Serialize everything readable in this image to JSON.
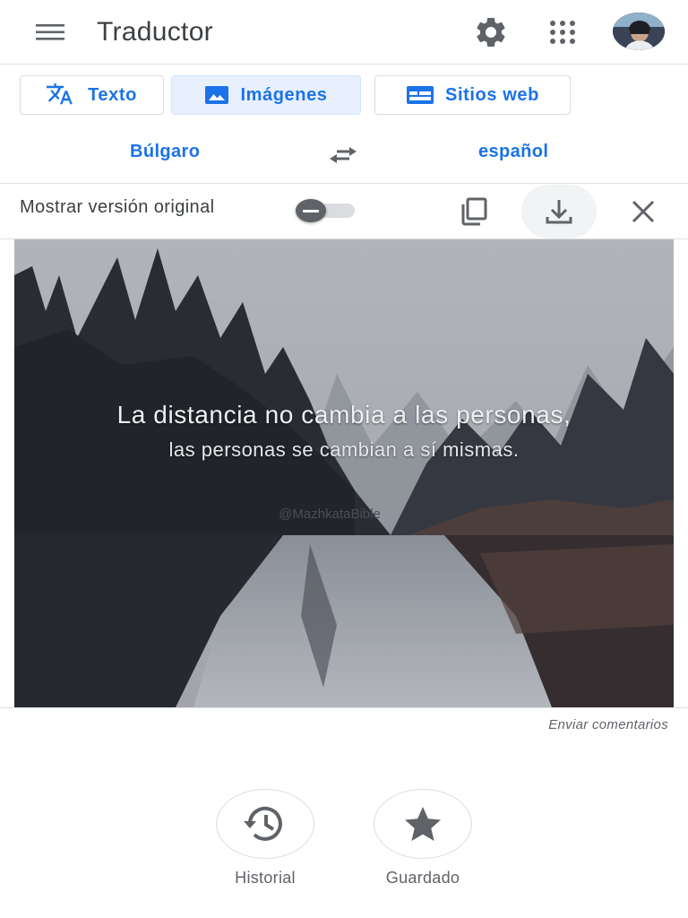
{
  "header": {
    "title": "Traductor"
  },
  "tabs": [
    {
      "label": "Texto",
      "icon": "translate-icon"
    },
    {
      "label": "Imágenes",
      "icon": "image-icon",
      "active": true
    },
    {
      "label": "Sitios web",
      "icon": "web-icon"
    }
  ],
  "languages": {
    "source": "Búlgaro",
    "target": "español"
  },
  "options": {
    "show_original_label": "Mostrar versión original",
    "show_original_on": false
  },
  "image": {
    "line1": "La distancia no cambia a las personas,",
    "line2": "las personas se cambian a sí mismas.",
    "watermark": "@MazhkataBible"
  },
  "feedback": "Enviar comentarios",
  "bottom": {
    "history_label": "Historial",
    "saved_label": "Guardado"
  },
  "colors": {
    "accent": "#1a73e8",
    "active_tab_bg": "#e8f0fe",
    "icon_gray": "#5f6368"
  }
}
